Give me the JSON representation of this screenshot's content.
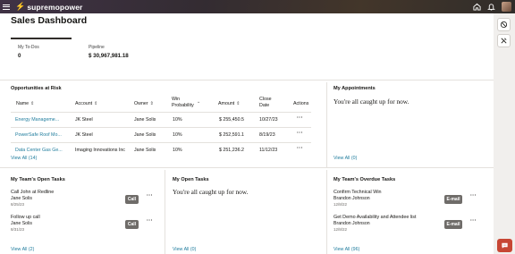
{
  "brand": {
    "name_part1": "supremo",
    "name_part2": "power"
  },
  "page": {
    "title": "Sales Dashboard"
  },
  "metrics": [
    {
      "label": "My To-Dos",
      "value": "0"
    },
    {
      "label": "Pipeline",
      "value": "$ 30,967,981.18"
    }
  ],
  "opportunities": {
    "title": "Opportunities at Risk",
    "columns": [
      "Name",
      "Account",
      "Owner",
      "Win Probability",
      "Amount",
      "Close Date",
      "Actions"
    ],
    "rows": [
      {
        "name": "Energy Manageme...",
        "account": "JK Steel",
        "owner": "Jane Solis",
        "win": "10%",
        "amount": "$ 255,450.5",
        "close": "10/27/23"
      },
      {
        "name": "PowerSafe Roof Mo...",
        "account": "JK Steel",
        "owner": "Jane Solis",
        "win": "10%",
        "amount": "$ 252,591.1",
        "close": "8/19/23"
      },
      {
        "name": "Data Center Gas Ge...",
        "account": "Imaging Innovations Inc",
        "owner": "Jane Solis",
        "win": "10%",
        "amount": "$ 251,236.2",
        "close": "11/12/23"
      }
    ],
    "view_all": "View All (14)"
  },
  "appointments": {
    "title": "My Appointments",
    "empty": "You're all caught up for now.",
    "view_all": "View All (0)"
  },
  "team_open_tasks": {
    "title": "My Team's Open Tasks",
    "items": [
      {
        "title": "Call John at Redline",
        "owner": "Jane Solis",
        "date": "8/25/23",
        "action": "Call"
      },
      {
        "title": "Follow up call",
        "owner": "Jane Solis",
        "date": "8/31/23",
        "action": "Call"
      }
    ],
    "view_all": "View All (2)"
  },
  "open_tasks": {
    "title": "My Open Tasks",
    "empty": "You're all caught up for now.",
    "view_all": "View All (0)"
  },
  "team_overdue_tasks": {
    "title": "My Team's Overdue Tasks",
    "items": [
      {
        "title": "Confirm Technical Win",
        "owner": "Brandon Johnson",
        "date": "12/8/22",
        "action": "E-mail"
      },
      {
        "title": "Get Demo Availability and Attendee list",
        "owner": "Brandon Johnson",
        "date": "12/8/22",
        "action": "E-mail"
      }
    ],
    "view_all": "View All (96)"
  },
  "icons": {
    "menu": "hamburger-icon",
    "home": "home-icon",
    "bell": "bell-icon",
    "avatar": "user-avatar",
    "block": "block-icon",
    "tools": "tools-icon",
    "chat": "chat-icon"
  },
  "colors": {
    "topbar": "#312d2a",
    "link": "#227e9e",
    "pill": "#6f6c69",
    "chat": "#c74634",
    "accent": "#2f9be0"
  }
}
